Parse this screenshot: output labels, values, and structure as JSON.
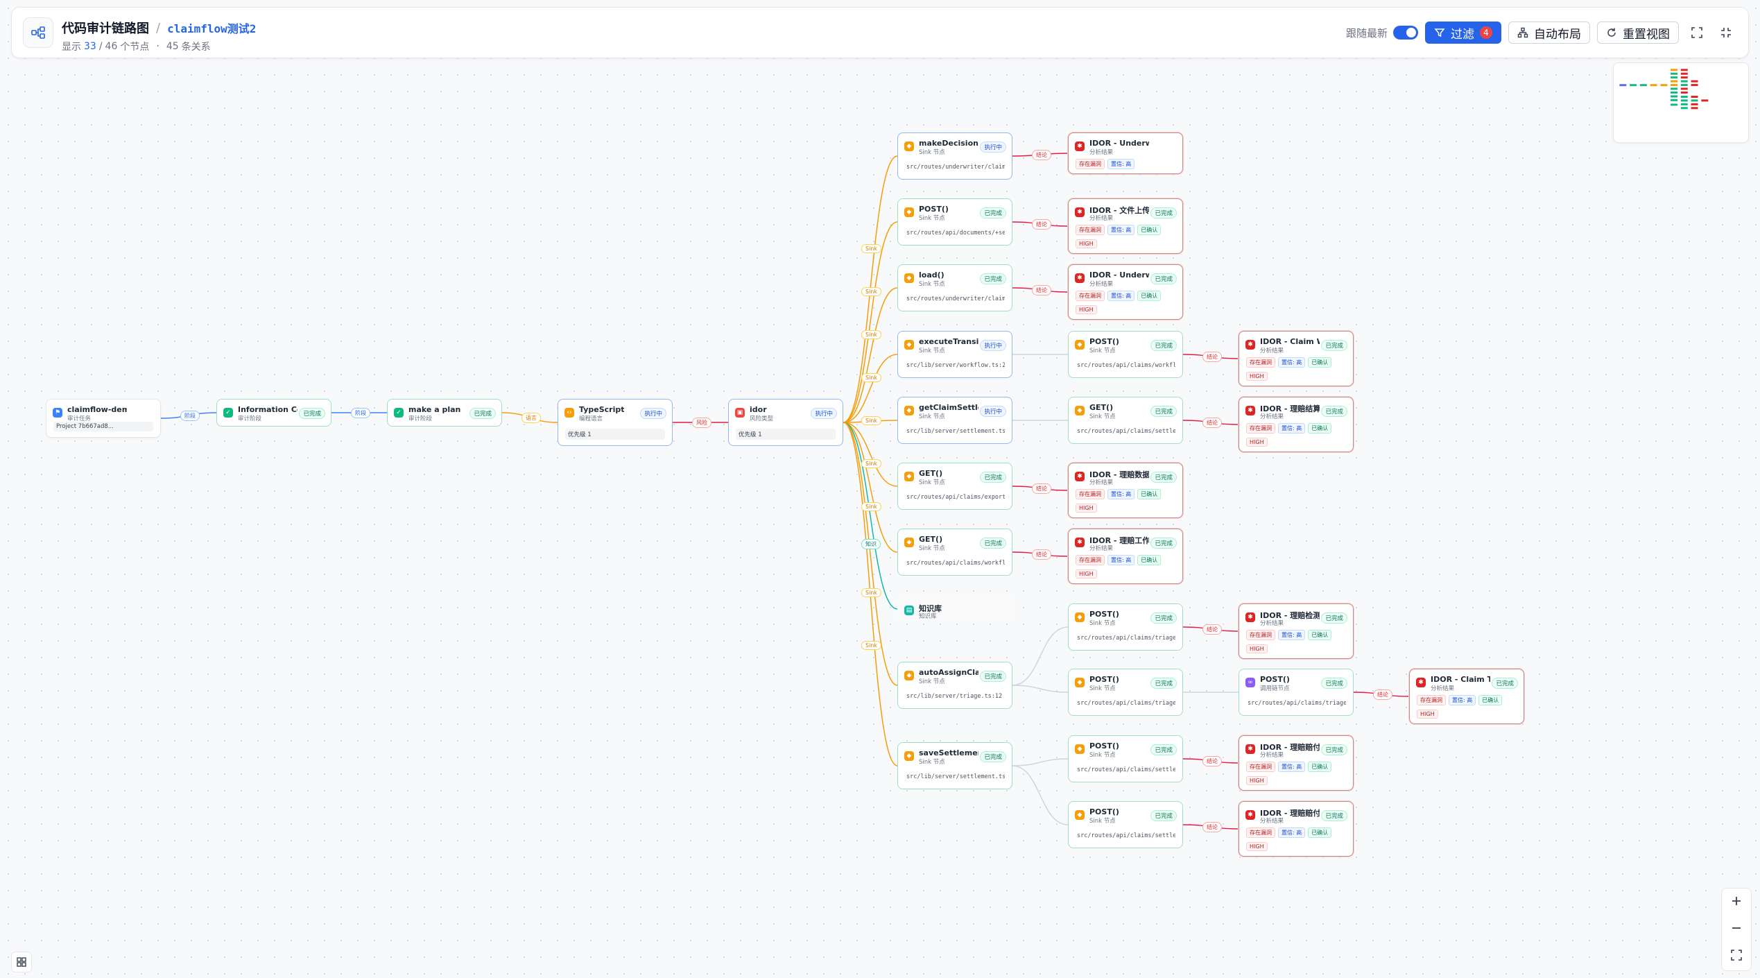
{
  "header": {
    "title": "代码审计链路图",
    "separator": "/",
    "project": "claimflow测试2",
    "shown_label": "显示",
    "shown": "33",
    "slash": "/",
    "total": "46",
    "nodes_label": "个节点",
    "dot": "·",
    "relations": "45",
    "relations_label": "条关系",
    "follow_label": "跟随最新",
    "filter_label": "过滤",
    "filter_count": "4",
    "auto_layout_label": "自动布局",
    "reset_view_label": "重置视图"
  },
  "colors": {
    "done_border": "#9ee0c5",
    "running_border": "#93b9f1",
    "finding_border": "#c98b86",
    "edge_blue": "#3b82f6",
    "edge_orange": "#f59e0b",
    "edge_red": "#e11d48",
    "edge_green": "#10b981",
    "edge_teal": "#14b8a6"
  },
  "nodes": [
    {
      "id": "root",
      "kind": "start",
      "icon": "flag-icon",
      "title": "claimflow-demo",
      "sub": "审计任务",
      "ctx": "Project 7b667ad8..."
    },
    {
      "id": "info",
      "kind": "done",
      "icon": "check-circle-icon",
      "title": "Information Col…",
      "sub": "审计阶段",
      "status": "已完成"
    },
    {
      "id": "plan",
      "kind": "done",
      "icon": "check-circle-icon",
      "title": "make a plan",
      "sub": "审计阶段",
      "status": "已完成"
    },
    {
      "id": "ts",
      "kind": "run",
      "icon": "code-icon",
      "title": "TypeScript",
      "sub": "编程语言",
      "status": "执行中",
      "ctx": "优先级 1"
    },
    {
      "id": "idor",
      "kind": "run",
      "icon": "lock-icon",
      "title": "idor",
      "sub": "风险类型",
      "status": "执行中",
      "ctx": "优先级 1"
    },
    {
      "id": "s1",
      "kind": "run",
      "icon": "shield-icon",
      "title": "makeDecision()",
      "sub": "Sink 节点",
      "status": "执行中",
      "path": "src/routes/underwriter/claims/[…"
    },
    {
      "id": "s2",
      "kind": "done",
      "icon": "shield-icon",
      "title": "POST()",
      "sub": "Sink 节点",
      "status": "已完成",
      "path": "src/routes/api/documents/+serve…"
    },
    {
      "id": "s3",
      "kind": "done",
      "icon": "shield-icon",
      "title": "load()",
      "sub": "Sink 节点",
      "status": "已完成",
      "path": "src/routes/underwriter/claims/[…"
    },
    {
      "id": "s4",
      "kind": "run",
      "icon": "shield-icon",
      "title": "executeTransiti…",
      "sub": "Sink 节点",
      "status": "执行中",
      "path": "src/lib/server/workflow.ts:208"
    },
    {
      "id": "s5",
      "kind": "run",
      "icon": "shield-icon",
      "title": "getClaimSettle…",
      "sub": "Sink 节点",
      "status": "执行中",
      "path": "src/lib/server/settlement.ts:279"
    },
    {
      "id": "s6",
      "kind": "done",
      "icon": "shield-icon",
      "title": "GET()",
      "sub": "Sink 节点",
      "status": "已完成",
      "path": "src/routes/api/claims/export/+s…"
    },
    {
      "id": "s7",
      "kind": "done",
      "icon": "shield-icon",
      "title": "GET()",
      "sub": "Sink 节点",
      "status": "已完成",
      "path": "src/routes/api/claims/workflow/…"
    },
    {
      "id": "kb",
      "kind": "kb",
      "icon": "document-icon",
      "title": "知识库",
      "sub": "知识库"
    },
    {
      "id": "s8",
      "kind": "done",
      "icon": "shield-icon",
      "title": "autoAssignClai…",
      "sub": "Sink 节点",
      "status": "已完成",
      "path": "src/lib/server/triage.ts:12"
    },
    {
      "id": "s9",
      "kind": "done",
      "icon": "shield-icon",
      "title": "saveSettlement…",
      "sub": "Sink 节点",
      "status": "已完成",
      "path": "src/lib/server/settlement.ts:115"
    },
    {
      "id": "f1",
      "kind": "find",
      "icon": "bug-icon",
      "title": "IDOR - Underwriter make…",
      "sub": "分析结果",
      "tags": [
        "存在漏洞",
        "置信: 高"
      ]
    },
    {
      "id": "f2",
      "kind": "find",
      "icon": "bug-icon",
      "title": "IDOR - 文件上传…",
      "sub": "分析结果",
      "status": "已完成",
      "tags": [
        "存在漏洞",
        "置信: 高",
        "已确认"
      ],
      "high": "HIGH"
    },
    {
      "id": "f3",
      "kind": "find",
      "icon": "bug-icon",
      "title": "IDOR - Underwr…",
      "sub": "分析结果",
      "status": "已完成",
      "tags": [
        "存在漏洞",
        "置信: 高",
        "已确认"
      ],
      "high": "HIGH"
    },
    {
      "id": "p4",
      "kind": "done",
      "icon": "shield-icon",
      "title": "POST()",
      "sub": "Sink 节点",
      "status": "已完成",
      "path": "src/routes/api/claims/workflow/…"
    },
    {
      "id": "p5",
      "kind": "done",
      "icon": "shield-icon",
      "title": "GET()",
      "sub": "Sink 节点",
      "status": "已完成",
      "path": "src/routes/api/claims/settlemen…"
    },
    {
      "id": "f6",
      "kind": "find",
      "icon": "bug-icon",
      "title": "IDOR - 理赔数据…",
      "sub": "分析结果",
      "status": "已完成",
      "tags": [
        "存在漏洞",
        "置信: 高",
        "已确认"
      ],
      "high": "HIGH"
    },
    {
      "id": "f7",
      "kind": "find",
      "icon": "bug-icon",
      "title": "IDOR - 理赔工作…",
      "sub": "分析结果",
      "status": "已完成",
      "tags": [
        "存在漏洞",
        "置信: 高",
        "已确认"
      ],
      "high": "HIGH"
    },
    {
      "id": "p8a",
      "kind": "done",
      "icon": "shield-icon",
      "title": "POST()",
      "sub": "Sink 节点",
      "status": "已完成",
      "path": "src/routes/api/claims/triage/+s…"
    },
    {
      "id": "p8b",
      "kind": "done",
      "icon": "shield-icon",
      "title": "POST()",
      "sub": "Sink 节点",
      "status": "已完成",
      "path": "src/routes/api/claims/triage/+s…"
    },
    {
      "id": "p9a",
      "kind": "done",
      "icon": "shield-icon",
      "title": "POST()",
      "sub": "Sink 节点",
      "status": "已完成",
      "path": "src/routes/api/claims/settlemen…"
    },
    {
      "id": "p9b",
      "kind": "done",
      "icon": "shield-icon",
      "title": "POST()",
      "sub": "Sink 节点",
      "status": "已完成",
      "path": "src/routes/api/claims/settlemen…"
    },
    {
      "id": "f4",
      "kind": "find",
      "icon": "bug-icon",
      "title": "IDOR - Claim W…",
      "sub": "分析结果",
      "status": "已完成",
      "tags": [
        "存在漏洞",
        "置信: 高",
        "已确认"
      ],
      "high": "HIGH"
    },
    {
      "id": "f5",
      "kind": "find",
      "icon": "bug-icon",
      "title": "IDOR - 理赔结算…",
      "sub": "分析结果",
      "status": "已完成",
      "tags": [
        "存在漏洞",
        "置信: 高",
        "已确认"
      ],
      "high": "HIGH"
    },
    {
      "id": "f8a",
      "kind": "find",
      "icon": "bug-icon",
      "title": "IDOR - 理赔检测…",
      "sub": "分析结果",
      "status": "已完成",
      "tags": [
        "存在漏洞",
        "置信: 高",
        "已确认"
      ],
      "high": "HIGH"
    },
    {
      "id": "c8b",
      "kind": "done",
      "icon": "link-icon",
      "title": "POST()",
      "sub": "调用链节点",
      "status": "已完成",
      "path": "src/routes/api/claims/triage/+s…"
    },
    {
      "id": "f9a",
      "kind": "find",
      "icon": "bug-icon",
      "title": "IDOR - 理赔赔付…",
      "sub": "分析结果",
      "status": "已完成",
      "tags": [
        "存在漏洞",
        "置信: 高",
        "已确认"
      ],
      "high": "HIGH"
    },
    {
      "id": "f9b",
      "kind": "find",
      "icon": "bug-icon",
      "title": "IDOR - 理赔赔付…",
      "sub": "分析结果",
      "status": "已完成",
      "tags": [
        "存在漏洞",
        "置信: 高",
        "已确认"
      ],
      "high": "HIGH"
    },
    {
      "id": "f8b",
      "kind": "find",
      "icon": "bug-icon",
      "title": "IDOR - Claim Tri…",
      "sub": "分析结果",
      "status": "已完成",
      "tags": [
        "存在漏洞",
        "置信: 高",
        "已确认"
      ],
      "high": "HIGH"
    }
  ],
  "edges": [
    {
      "from": "root",
      "to": "info",
      "label": "阶段",
      "color": "blue"
    },
    {
      "from": "info",
      "to": "plan",
      "label": "阶段",
      "color": "blue"
    },
    {
      "from": "plan",
      "to": "ts",
      "label": "语言",
      "color": "orange"
    },
    {
      "from": "ts",
      "to": "idor",
      "label": "风险",
      "color": "red"
    },
    {
      "from": "idor",
      "to": "s1",
      "label": "Sink",
      "color": "orange"
    },
    {
      "from": "idor",
      "to": "s2",
      "label": "Sink",
      "color": "orange"
    },
    {
      "from": "idor",
      "to": "s3",
      "label": "Sink",
      "color": "orange"
    },
    {
      "from": "idor",
      "to": "s4",
      "label": "Sink",
      "color": "orange"
    },
    {
      "from": "idor",
      "to": "s5",
      "label": "Sink",
      "color": "orange"
    },
    {
      "from": "idor",
      "to": "s6",
      "label": "Sink",
      "color": "orange"
    },
    {
      "from": "idor",
      "to": "s7",
      "label": "Sink",
      "color": "orange"
    },
    {
      "from": "idor",
      "to": "kb",
      "label": "知识",
      "color": "teal"
    },
    {
      "from": "idor",
      "to": "s8",
      "label": "Sink",
      "color": "orange"
    },
    {
      "from": "idor",
      "to": "s9",
      "label": "Sink",
      "color": "orange"
    },
    {
      "from": "s1",
      "to": "f1",
      "label": "结论",
      "color": "red"
    },
    {
      "from": "s2",
      "to": "f2",
      "label": "结论",
      "color": "red"
    },
    {
      "from": "s3",
      "to": "f3",
      "label": "结论",
      "color": "red"
    },
    {
      "from": "s4",
      "to": "p4",
      "label": "",
      "color": "gray"
    },
    {
      "from": "s5",
      "to": "p5",
      "label": "",
      "color": "gray"
    },
    {
      "from": "s6",
      "to": "f6",
      "label": "结论",
      "color": "red"
    },
    {
      "from": "s7",
      "to": "f7",
      "label": "结论",
      "color": "red"
    },
    {
      "from": "s8",
      "to": "p8a",
      "label": "",
      "color": "gray"
    },
    {
      "from": "s8",
      "to": "p8b",
      "label": "",
      "color": "gray"
    },
    {
      "from": "s9",
      "to": "p9a",
      "label": "",
      "color": "gray"
    },
    {
      "from": "s9",
      "to": "p9b",
      "label": "",
      "color": "gray"
    },
    {
      "from": "p4",
      "to": "f4",
      "label": "结论",
      "color": "red"
    },
    {
      "from": "p5",
      "to": "f5",
      "label": "结论",
      "color": "red"
    },
    {
      "from": "p8a",
      "to": "f8a",
      "label": "结论",
      "color": "red"
    },
    {
      "from": "p8b",
      "to": "c8b",
      "label": "",
      "color": "gray"
    },
    {
      "from": "c8b",
      "to": "f8b",
      "label": "结论",
      "color": "red"
    },
    {
      "from": "p9a",
      "to": "f9a",
      "label": "结论",
      "color": "red"
    },
    {
      "from": "p9b",
      "to": "f9b",
      "label": "结论",
      "color": "red"
    }
  ]
}
